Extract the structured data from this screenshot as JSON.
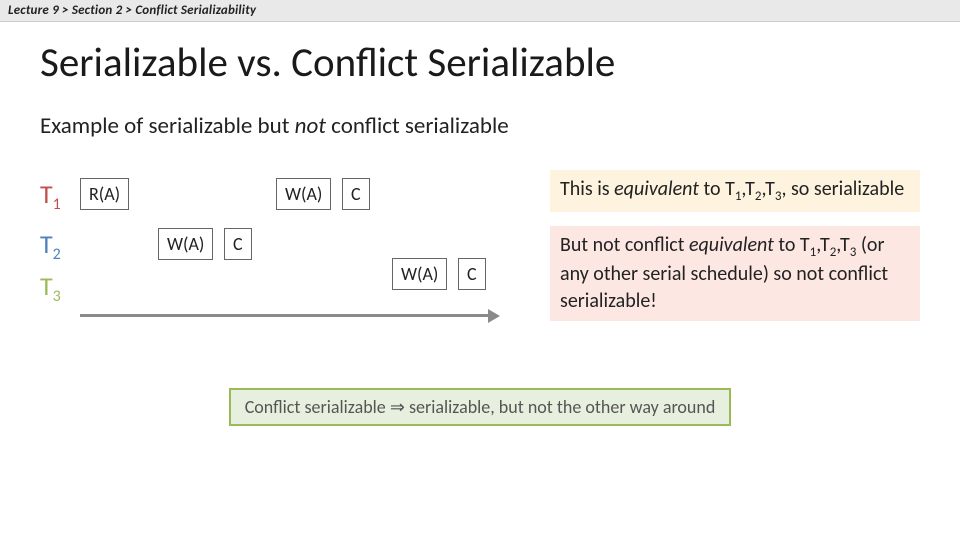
{
  "breadcrumb": "Lecture 9  >  Section 2  >  Conflict Serializability",
  "title": "Serializable vs. Conflict Serializable",
  "subtitle_pre": "Example of serializable but ",
  "subtitle_not": "not",
  "subtitle_post": " conflict serializable",
  "tx": {
    "t1": "T",
    "t2": "T",
    "t3": "T",
    "s1": "1",
    "s2": "2",
    "s3": "3"
  },
  "ops": {
    "ra": "R(A)",
    "wa": "W(A)",
    "c": "C"
  },
  "note1_a": "This is ",
  "note1_b": "equivalent",
  "note1_c": " to T",
  "note1_d": ",T",
  "note1_e": ",T",
  "note1_f": ", so serializable",
  "note2_a": "But not conflict ",
  "note2_b": "equivalent",
  "note2_c": " to T",
  "note2_d": ",T",
  "note2_e": ",T",
  "note2_f": " (or any other serial schedule) so not conflict serializable!",
  "callout": "Conflict serializable ⇒ serializable, but not the other way around"
}
